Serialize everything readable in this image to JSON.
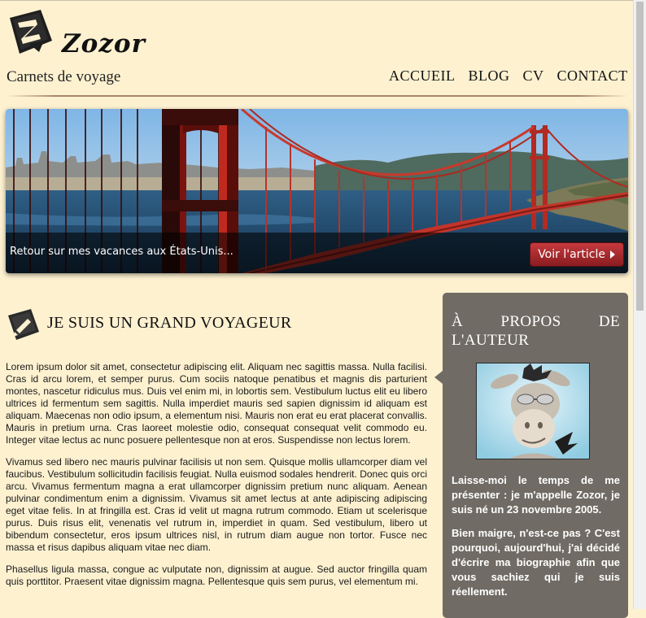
{
  "header": {
    "brand": "Zozor",
    "tagline": "Carnets de voyage",
    "nav": [
      "ACCUEIL",
      "BLOG",
      "CV",
      "CONTACT"
    ]
  },
  "banner": {
    "caption": "Retour sur mes vacances aux États-Unis...",
    "button_label": "Voir l'article"
  },
  "article": {
    "title": "JE SUIS UN GRAND VOYAGEUR",
    "paragraphs": [
      "Lorem ipsum dolor sit amet, consectetur adipiscing elit. Aliquam nec sagittis massa. Nulla facilisi. Cras id arcu lorem, et semper purus. Cum sociis natoque penatibus et magnis dis parturient montes, nascetur ridiculus mus. Duis vel enim mi, in lobortis sem. Vestibulum luctus elit eu libero ultrices id fermentum sem sagittis. Nulla imperdiet mauris sed sapien dignissim id aliquam est aliquam. Maecenas non odio ipsum, a elementum nisi. Mauris non erat eu erat placerat convallis. Mauris in pretium urna. Cras laoreet molestie odio, consequat consequat velit commodo eu. Integer vitae lectus ac nunc posuere pellentesque non at eros. Suspendisse non lectus lorem.",
      "Vivamus sed libero nec mauris pulvinar facilisis ut non sem. Quisque mollis ullamcorper diam vel faucibus. Vestibulum sollicitudin facilisis feugiat. Nulla euismod sodales hendrerit. Donec quis orci arcu. Vivamus fermentum magna a erat ullamcorper dignissim pretium nunc aliquam. Aenean pulvinar condimentum enim a dignissim. Vivamus sit amet lectus at ante adipiscing adipiscing eget vitae felis. In at fringilla est. Cras id velit ut magna rutrum commodo. Etiam ut scelerisque purus. Duis risus elit, venenatis vel rutrum in, imperdiet in quam. Sed vestibulum, libero ut bibendum consectetur, eros ipsum ultrices nisl, in rutrum diam augue non tortor. Fusce nec massa et risus dapibus aliquam vitae nec diam.",
      "Phasellus ligula massa, congue ac vulputate non, dignissim at augue. Sed auctor fringilla quam quis porttitor. Praesent vitae dignissim magna. Pellentesque quis sem purus, vel elementum mi."
    ]
  },
  "sidebar": {
    "title_line1": "À PROPOS DE",
    "title_line2": "L'AUTEUR",
    "paragraphs": [
      "Laisse-moi le temps de me présenter : je m'appelle Zozor, je suis né un 23 novembre 2005.",
      "Bien maigre, n'est-ce pas ? C'est pourquoi, aujourd'hui, j'ai décidé d'écrire ma biographie afin que vous sachiez qui je suis réellement."
    ]
  },
  "colors": {
    "page_background": "#fdf1d0",
    "sidebar_background": "#706b64",
    "button_red": "#b3292e",
    "header_rule": "#a9856e"
  }
}
